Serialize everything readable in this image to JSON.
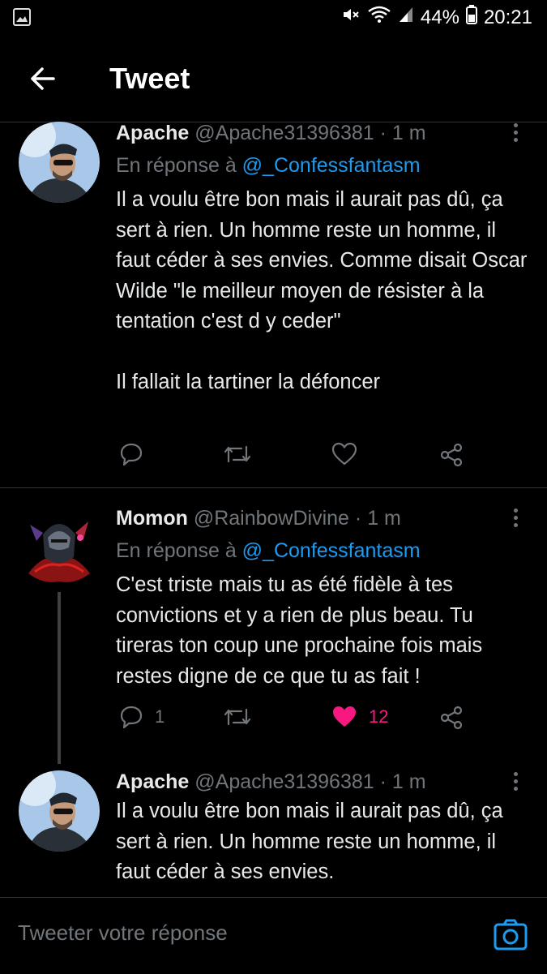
{
  "statusbar": {
    "battery": "44%",
    "time": "20:21"
  },
  "header": {
    "title": "Tweet"
  },
  "tweets": [
    {
      "name": "Apache",
      "handle": "@Apache31396381",
      "time": "· 1 m",
      "reply_prefix": "En réponse à",
      "reply_handle": "@_Confessfantasm",
      "text": "Il a voulu être bon mais il aurait pas dû, ça sert à rien. Un homme reste un homme, il faut céder à ses envies. Comme disait Oscar Wilde \"le meilleur moyen de résister à la tentation c'est d y ceder\"\n\nIl fallait la tartiner la défoncer"
    },
    {
      "name": "Momon",
      "handle": "@RainbowDivine",
      "time": "· 1 m",
      "reply_prefix": "En réponse à",
      "reply_handle": "@_Confessfantasm",
      "text": "C'est triste mais tu as été fidèle à tes convictions et y a rien de plus beau. Tu tireras ton coup une prochaine fois mais restes digne de ce que tu as fait !",
      "reply_count": "1",
      "like_count": "12",
      "like_color": "#f91880"
    },
    {
      "name": "Apache",
      "handle": "@Apache31396381",
      "time": "· 1 m",
      "text": "Il a voulu être bon mais il aurait pas dû, ça sert à rien. Un homme reste un homme, il faut céder à ses envies."
    }
  ],
  "composer": {
    "placeholder": "Tweeter votre réponse"
  },
  "colors": {
    "accent": "#1d9bf0",
    "like": "#f91880",
    "muted": "#71767b"
  }
}
